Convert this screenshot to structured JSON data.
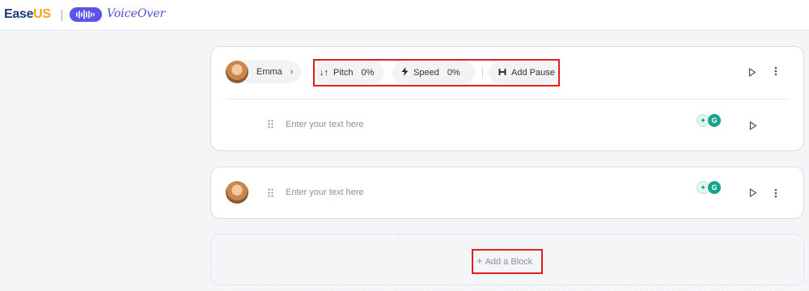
{
  "header": {
    "brand_ease": "Ease",
    "brand_us": "US",
    "product_name": "VoiceOver",
    "brand_colors": {
      "navy": "#1c3a7a",
      "orange": "#f5a31a",
      "purple": "#5a55e8"
    }
  },
  "blocks": [
    {
      "voice_name": "Emma",
      "chevron_icon": "chevron-right-icon",
      "pitch_label": "Pitch",
      "pitch_value": "0%",
      "speed_label": "Speed",
      "speed_value": "0%",
      "add_pause_label": "Add Pause",
      "text_placeholder": "Enter your text here"
    },
    {
      "text_placeholder": "Enter your text here"
    }
  ],
  "add_block_label": "Add a Block",
  "highlight_color": "#e02020"
}
